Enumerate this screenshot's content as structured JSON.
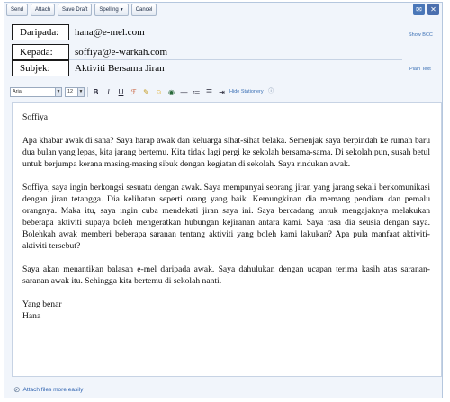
{
  "toolbar": {
    "send": "Send",
    "attach": "Attach",
    "save_draft": "Save Draft",
    "spelling": "Spelling",
    "cancel": "Cancel"
  },
  "header": {
    "from_label": "Daripada:",
    "from_value": "hana@e-mel.com",
    "to_label": "Kepada:",
    "to_value": "soffiya@e-warkah.com",
    "subject_label": "Subjek:",
    "subject_value": "Aktiviti Bersama Jiran",
    "show_bcc": "Show BCC",
    "plain_text": "Plain Text"
  },
  "format": {
    "font": "Arial",
    "size": "12",
    "stationery": "Hide Stationery"
  },
  "message": {
    "greeting": "Soffiya",
    "p1": "Apa khabar awak di sana? Saya harap awak dan keluarga sihat-sihat belaka. Semenjak saya berpindah ke rumah baru dua bulan yang lepas, kita jarang bertemu. Kita tidak lagi pergi ke sekolah bersama-sama. Di sekolah pun, susah betul untuk berjumpa kerana masing-masing sibuk dengan kegiatan di sekolah. Saya rindukan awak.",
    "p2": "Soffiya, saya ingin berkongsi sesuatu dengan awak. Saya mempunyai seorang jiran yang jarang sekali berkomunikasi dengan jiran tetangga. Dia kelihatan seperti orang yang baik. Kemungkinan dia memang pendiam dan pemalu orangnya. Maka itu, saya ingin cuba mendekati jiran saya ini. Saya bercadang untuk mengajaknya melakukan beberapa aktiviti supaya boleh mengeratkan hubungan kejiranan antara kami. Saya rasa dia seusia dengan saya. Bolehkah awak memberi beberapa saranan tentang aktiviti yang boleh kami lakukan? Apa pula manfaat aktiviti-aktiviti tersebut?",
    "p3": "Saya akan menantikan balasan e-mel daripada awak. Saya dahulukan dengan ucapan terima kasih atas saranan-saranan awak itu. Sehingga kita bertemu di sekolah nanti.",
    "closing": "Yang benar",
    "signature": "Hana"
  },
  "footer": {
    "attach_link": "Attach files more easily"
  }
}
